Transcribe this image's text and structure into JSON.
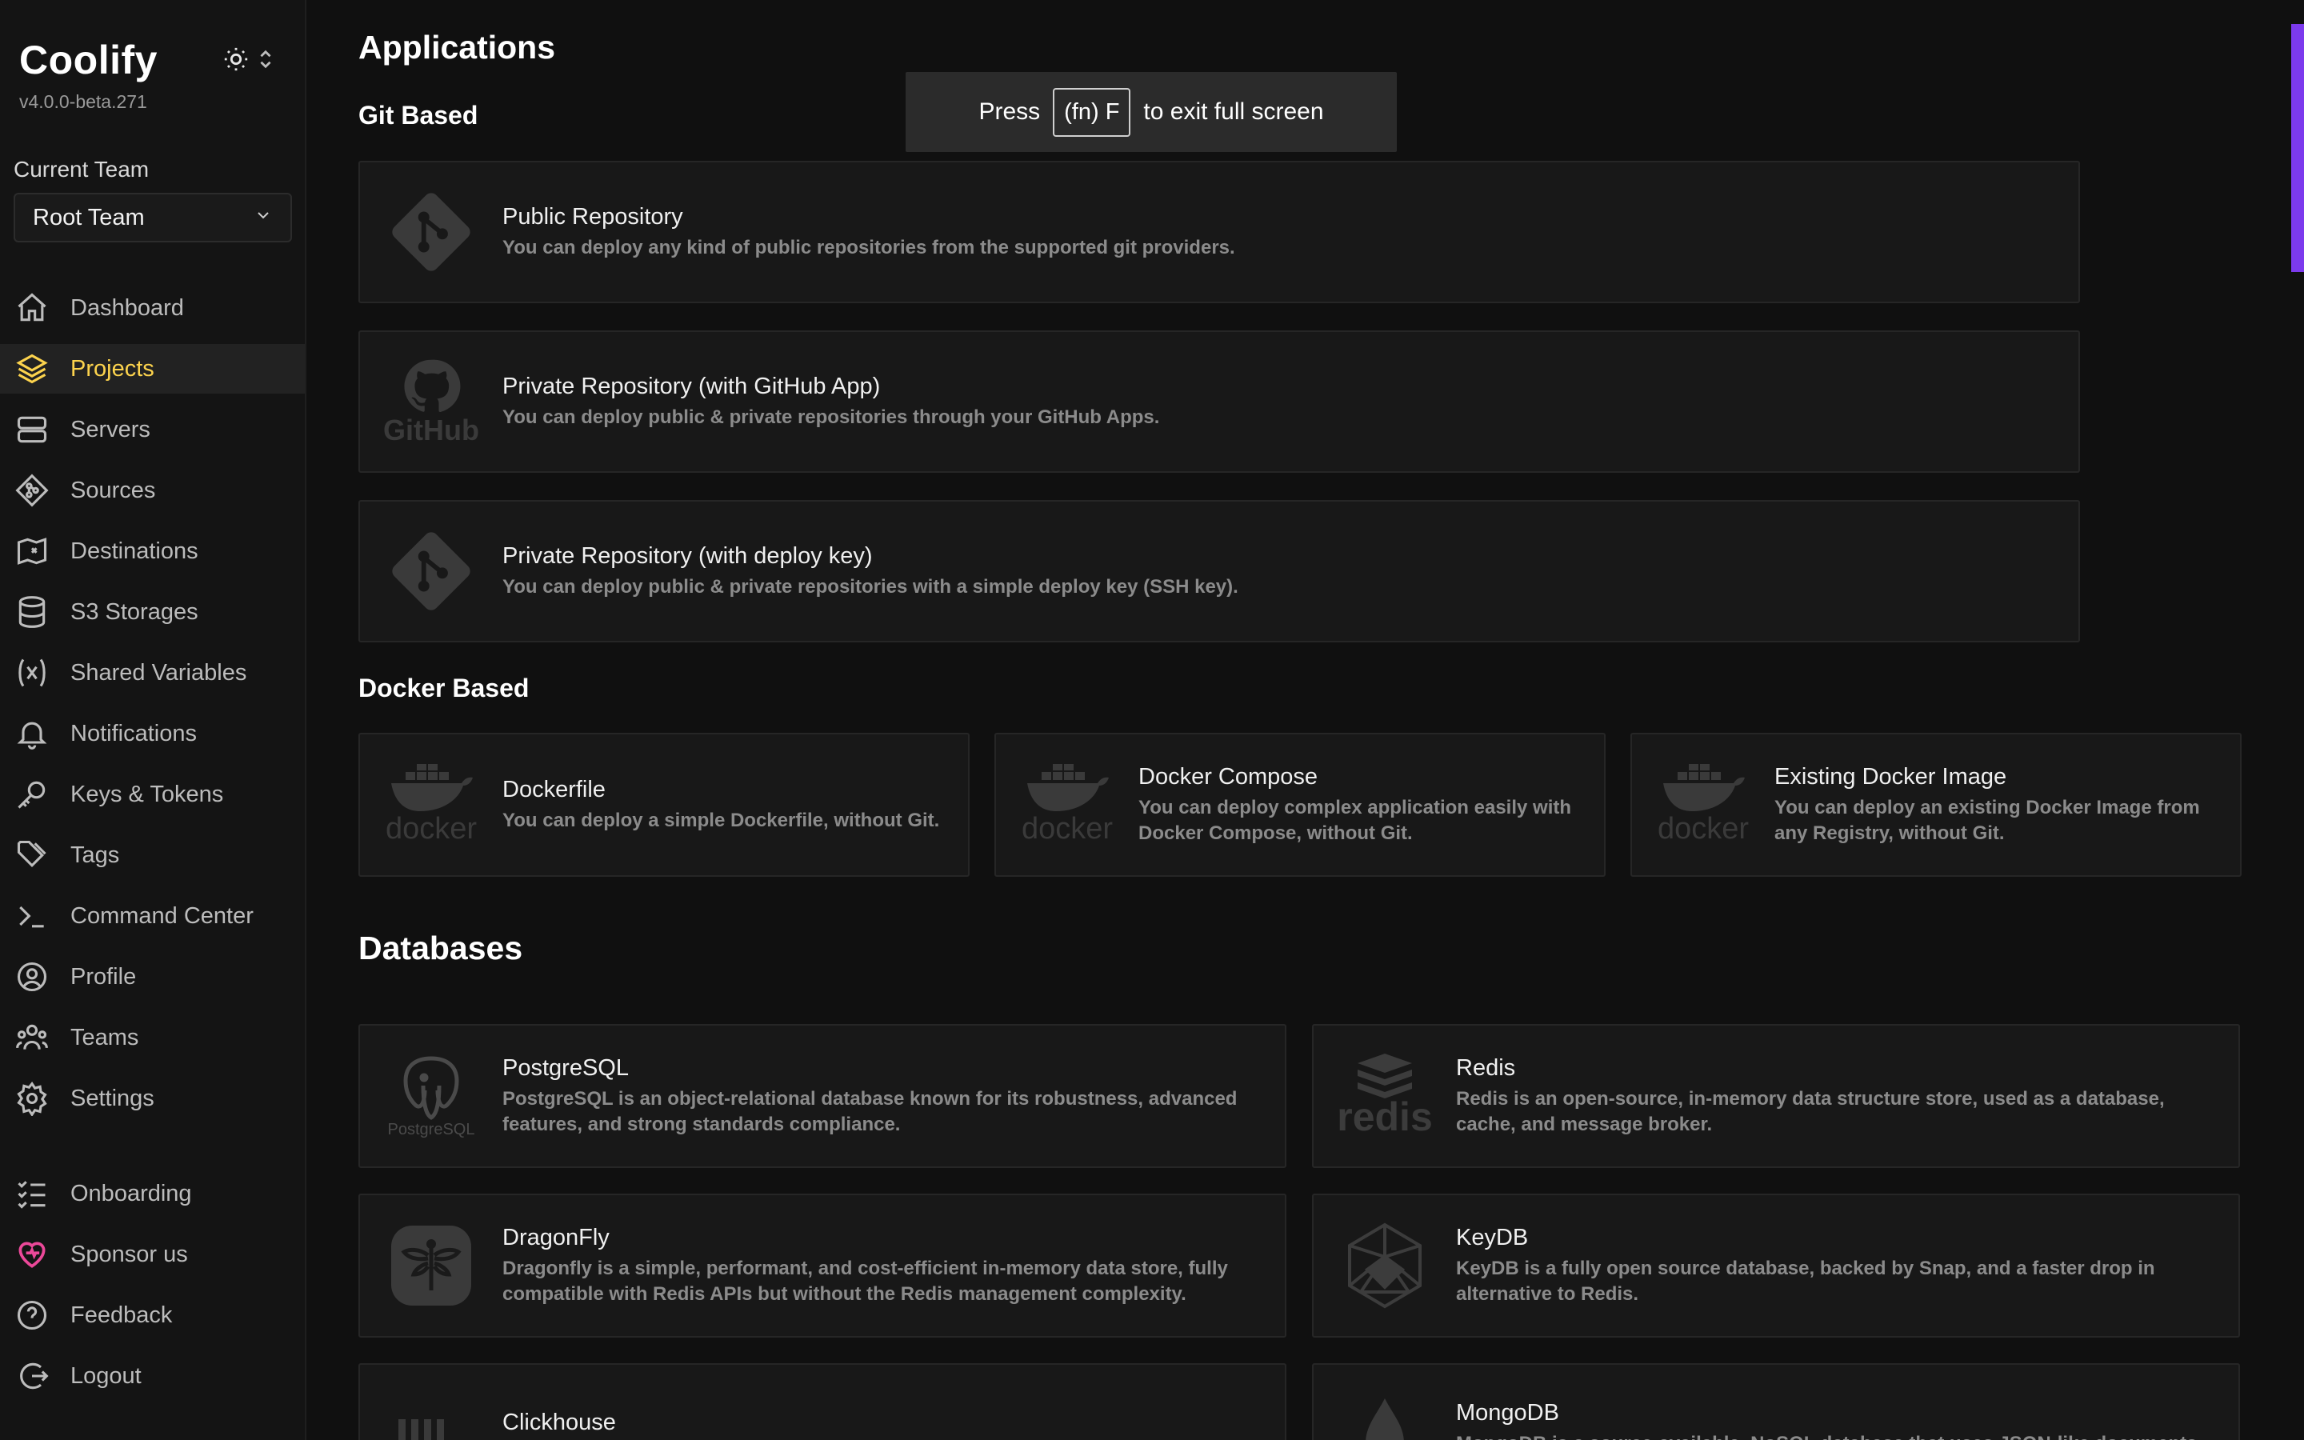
{
  "sidebar": {
    "brand": "Coolify",
    "version": "v4.0.0-beta.271",
    "team_label": "Current Team",
    "team_value": "Root Team",
    "nav": [
      {
        "label": "Dashboard"
      },
      {
        "label": "Projects"
      },
      {
        "label": "Servers"
      },
      {
        "label": "Sources"
      },
      {
        "label": "Destinations"
      },
      {
        "label": "S3 Storages"
      },
      {
        "label": "Shared Variables"
      },
      {
        "label": "Notifications"
      },
      {
        "label": "Keys & Tokens"
      },
      {
        "label": "Tags"
      },
      {
        "label": "Command Center"
      },
      {
        "label": "Profile"
      },
      {
        "label": "Teams"
      },
      {
        "label": "Settings"
      }
    ],
    "active_nav": "Projects",
    "bottom": [
      {
        "label": "Onboarding"
      },
      {
        "label": "Sponsor us"
      },
      {
        "label": "Feedback"
      },
      {
        "label": "Logout"
      }
    ]
  },
  "main": {
    "title": "Applications",
    "git_heading": "Git Based",
    "docker_heading": "Docker Based",
    "db_heading": "Databases",
    "git_cards": [
      {
        "title": "Public Repository",
        "desc": "You can deploy any kind of public repositories from the supported git providers.",
        "icon": "git-icon"
      },
      {
        "title": "Private Repository (with GitHub App)",
        "desc": "You can deploy public & private repositories through your GitHub Apps.",
        "icon": "github-icon",
        "logo_text": "GitHub"
      },
      {
        "title": "Private Repository (with deploy key)",
        "desc": "You can deploy public & private repositories with a simple deploy key (SSH key).",
        "icon": "git-icon"
      }
    ],
    "docker_cards": [
      {
        "title": "Dockerfile",
        "desc": "You can deploy a simple Dockerfile, without Git.",
        "logo_text": "docker"
      },
      {
        "title": "Docker Compose",
        "desc": "You can deploy complex application easily with Docker Compose, without Git.",
        "logo_text": "docker"
      },
      {
        "title": "Existing Docker Image",
        "desc": "You can deploy an existing Docker Image from any Registry, without Git.",
        "logo_text": "docker"
      }
    ],
    "db_cards": [
      {
        "title": "PostgreSQL",
        "desc": "PostgreSQL is an object-relational database known for its robustness, advanced features, and strong standards compliance.",
        "logo_text": "PostgreSQL"
      },
      {
        "title": "Redis",
        "desc": "Redis is an open-source, in-memory data structure store, used as a database, cache, and message broker.",
        "logo_text": "redis"
      },
      {
        "title": "DragonFly",
        "desc": "Dragonfly is a simple, performant, and cost-efficient in-memory data store, fully compatible with Redis APIs but without the Redis management complexity."
      },
      {
        "title": "KeyDB",
        "desc": "KeyDB is a fully open source database, backed by Snap, and a faster drop in alternative to Redis."
      },
      {
        "title": "Clickhouse",
        "desc": ""
      },
      {
        "title": "MongoDB",
        "desc": "MongoDB is a source-available, NoSQL database that uses JSON-like documents"
      }
    ]
  },
  "toast": {
    "press": "Press",
    "key": "(fn) F",
    "rest": "to exit full screen"
  },
  "colors": {
    "accent": "#7c3aed",
    "active_text": "#fcd34d",
    "background": "#101010",
    "card": "#181818"
  }
}
